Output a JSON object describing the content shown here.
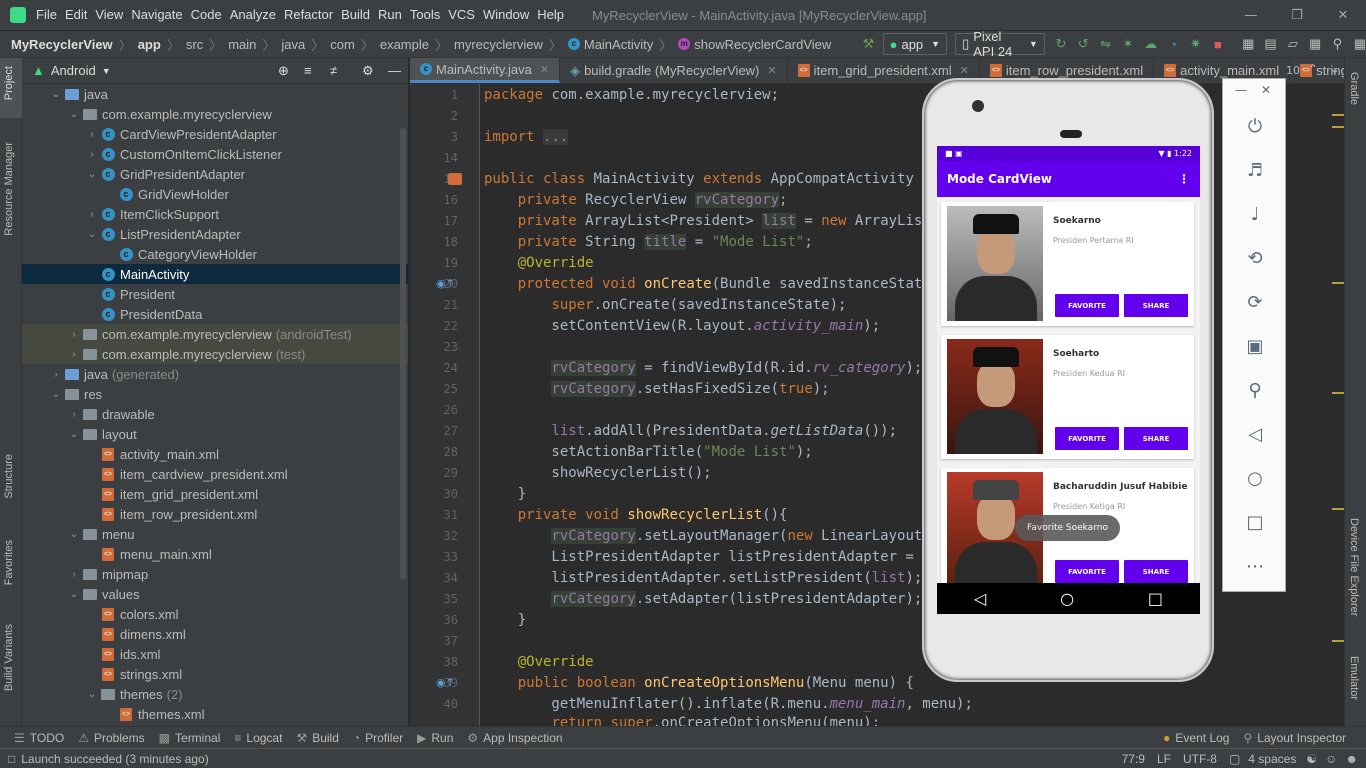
{
  "menubar": {
    "items": [
      "File",
      "Edit",
      "View",
      "Navigate",
      "Code",
      "Analyze",
      "Refactor",
      "Build",
      "Run",
      "Tools",
      "VCS",
      "Window",
      "Help"
    ],
    "window_title": "MyRecyclerView - MainActivity.java [MyRecyclerView.app]"
  },
  "navbar": {
    "crumbs": [
      "MyRecyclerView",
      "app",
      "src",
      "main",
      "java",
      "com",
      "example",
      "myrecyclerview",
      "MainActivity",
      "showRecyclerCardView"
    ],
    "run_config": "app",
    "device": "Pixel API 24"
  },
  "left_strip": [
    "Project",
    "Resource Manager",
    "Structure",
    "Favorites",
    "Build Variants"
  ],
  "right_strip": [
    "Gradle",
    "Device File Explorer",
    "Emulator"
  ],
  "project_panel": {
    "view_mode": "Android",
    "tree": [
      {
        "label": "java",
        "indent": 1,
        "arrow": "v",
        "icon": "folder-blue"
      },
      {
        "label": "com.example.myrecyclerview",
        "indent": 2,
        "arrow": "v",
        "icon": "folder"
      },
      {
        "label": "CardViewPresidentAdapter",
        "indent": 3,
        "arrow": ">",
        "icon": "class"
      },
      {
        "label": "CustomOnItemClickListener",
        "indent": 3,
        "arrow": ">",
        "icon": "class"
      },
      {
        "label": "GridPresidentAdapter",
        "indent": 3,
        "arrow": "v",
        "icon": "class"
      },
      {
        "label": "GridViewHolder",
        "indent": 4,
        "arrow": "",
        "icon": "class"
      },
      {
        "label": "ItemClickSupport",
        "indent": 3,
        "arrow": ">",
        "icon": "class"
      },
      {
        "label": "ListPresidentAdapter",
        "indent": 3,
        "arrow": "v",
        "icon": "class"
      },
      {
        "label": "CategoryViewHolder",
        "indent": 4,
        "arrow": "",
        "icon": "class"
      },
      {
        "label": "MainActivity",
        "indent": 3,
        "arrow": "",
        "icon": "class",
        "selected": true
      },
      {
        "label": "President",
        "indent": 3,
        "arrow": "",
        "icon": "class"
      },
      {
        "label": "PresidentData",
        "indent": 3,
        "arrow": "",
        "icon": "class"
      },
      {
        "label": "com.example.myrecyclerview",
        "suffix": "(androidTest)",
        "indent": 2,
        "arrow": ">",
        "icon": "folder",
        "tinted": true
      },
      {
        "label": "com.example.myrecyclerview",
        "suffix": "(test)",
        "indent": 2,
        "arrow": ">",
        "icon": "folder",
        "tinted": true
      },
      {
        "label": "java",
        "suffix": "(generated)",
        "indent": 1,
        "arrow": ">",
        "icon": "folder-blue"
      },
      {
        "label": "res",
        "indent": 1,
        "arrow": "v",
        "icon": "folder"
      },
      {
        "label": "drawable",
        "indent": 2,
        "arrow": ">",
        "icon": "folder"
      },
      {
        "label": "layout",
        "indent": 2,
        "arrow": "v",
        "icon": "folder"
      },
      {
        "label": "activity_main.xml",
        "indent": 3,
        "arrow": "",
        "icon": "xml"
      },
      {
        "label": "item_cardview_president.xml",
        "indent": 3,
        "arrow": "",
        "icon": "xml"
      },
      {
        "label": "item_grid_president.xml",
        "indent": 3,
        "arrow": "",
        "icon": "xml"
      },
      {
        "label": "item_row_president.xml",
        "indent": 3,
        "arrow": "",
        "icon": "xml"
      },
      {
        "label": "menu",
        "indent": 2,
        "arrow": "v",
        "icon": "folder"
      },
      {
        "label": "menu_main.xml",
        "indent": 3,
        "arrow": "",
        "icon": "xml"
      },
      {
        "label": "mipmap",
        "indent": 2,
        "arrow": ">",
        "icon": "folder"
      },
      {
        "label": "values",
        "indent": 2,
        "arrow": "v",
        "icon": "folder"
      },
      {
        "label": "colors.xml",
        "indent": 3,
        "arrow": "",
        "icon": "xml"
      },
      {
        "label": "dimens.xml",
        "indent": 3,
        "arrow": "",
        "icon": "xml"
      },
      {
        "label": "ids.xml",
        "indent": 3,
        "arrow": "",
        "icon": "xml"
      },
      {
        "label": "strings.xml",
        "indent": 3,
        "arrow": "",
        "icon": "xml"
      },
      {
        "label": "themes",
        "suffix": "(2)",
        "indent": 3,
        "arrow": "v",
        "icon": "folder"
      },
      {
        "label": "themes.xml",
        "indent": 4,
        "arrow": "",
        "icon": "xml"
      }
    ]
  },
  "editor": {
    "tabs": [
      "MainActivity.java",
      "build.gradle (MyRecyclerView)",
      "item_grid_president.xml",
      "item_row_president.xml",
      "activity_main.xml",
      "string:"
    ],
    "line_numbers": [
      "1",
      "2",
      "3",
      "14",
      "15",
      "16",
      "17",
      "18",
      "19",
      "20",
      "21",
      "22",
      "23",
      "24",
      "25",
      "26",
      "27",
      "28",
      "29",
      "30",
      "31",
      "32",
      "33",
      "34",
      "35",
      "36",
      "37",
      "38",
      "39",
      "40"
    ],
    "overflow_count": "10"
  },
  "emulator": {
    "status_time": "1:22",
    "app_title": "Mode CardView",
    "cards": [
      {
        "name": "Soekarno",
        "desc": "Presiden Pertama RI"
      },
      {
        "name": "Soeharto",
        "desc": "Presiden Kedua RI"
      },
      {
        "name": "Bacharuddin Jusuf Habibie",
        "desc": "Presiden Ketiga RI"
      }
    ],
    "favorite_label": "FAVORITE",
    "share_label": "SHARE",
    "toast": "Favorite Soekarno"
  },
  "bottombar": [
    "TODO",
    "Problems",
    "Terminal",
    "Logcat",
    "Build",
    "Profiler",
    "Run",
    "App Inspection"
  ],
  "bottombar_right": [
    "Event Log",
    "Layout Inspector"
  ],
  "status": {
    "message": "Launch succeeded (3 minutes ago)",
    "position": "77:9",
    "line_sep": "LF",
    "encoding": "UTF-8",
    "indent": "4 spaces"
  }
}
